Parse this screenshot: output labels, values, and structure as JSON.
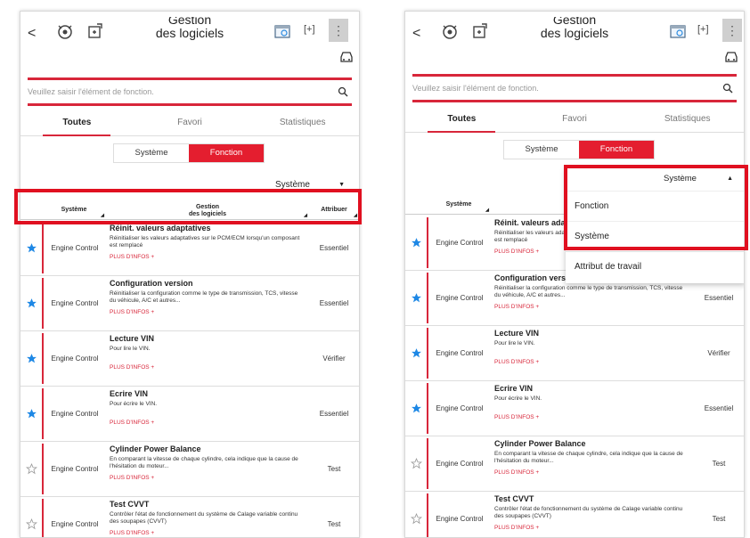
{
  "screen": {
    "title_line1": "Gestion",
    "title_line2": "des logiciels",
    "search_placeholder": "Veuillez saisir l'élément de fonction.",
    "tabs": [
      "Toutes",
      "Favori",
      "Statistiques"
    ],
    "segment": [
      "Système",
      "Fonction"
    ],
    "dropdown_value": "Système",
    "dropdown_options": [
      "Fonction",
      "Système",
      "Attribut de travail"
    ],
    "columns": {
      "system": "Système",
      "name_line1": "Gestion",
      "name_line2": "des logiciels",
      "attribute": "Attribuer"
    },
    "more_label": "PLUS D'INFOS +",
    "rows": [
      {
        "system": "Engine Control",
        "name": "Réinit. valeurs adaptatives",
        "desc": "Réinitialiser les valeurs adaptatives sur le PCM/ECM lorsqu'un composant est remplacé",
        "attribute": "Essentiel",
        "favorite": true
      },
      {
        "system": "Engine Control",
        "name": "Configuration version",
        "desc": "Réinitialiser la configuration comme le type de transmission, TCS, vitesse du véhicule, A/C et autres...",
        "attribute": "Essentiel",
        "favorite": true
      },
      {
        "system": "Engine Control",
        "name": "Lecture VIN",
        "desc": "Pour lire le VIN.",
        "attribute": "Vérifier",
        "favorite": true
      },
      {
        "system": "Engine Control",
        "name": "Ecrire VIN",
        "desc": "Pour écrire le VIN.",
        "attribute": "Essentiel",
        "favorite": true
      },
      {
        "system": "Engine Control",
        "name": "Cylinder Power Balance",
        "desc": "En comparant la vitesse de chaque cylindre, cela indique que la cause de l'hésitation du moteur...",
        "attribute": "Test",
        "favorite": false
      },
      {
        "system": "Engine Control",
        "name": "Test CVVT",
        "desc": "Contrôler l'état de fonctionnement du système de Calage variable continu des soupapes (CVVT)",
        "attribute": "Test",
        "favorite": false
      }
    ]
  },
  "colors": {
    "accent": "#d8263a",
    "segment_active": "#e41e2f",
    "highlight": "#e01020",
    "star": "#1e88e5"
  }
}
